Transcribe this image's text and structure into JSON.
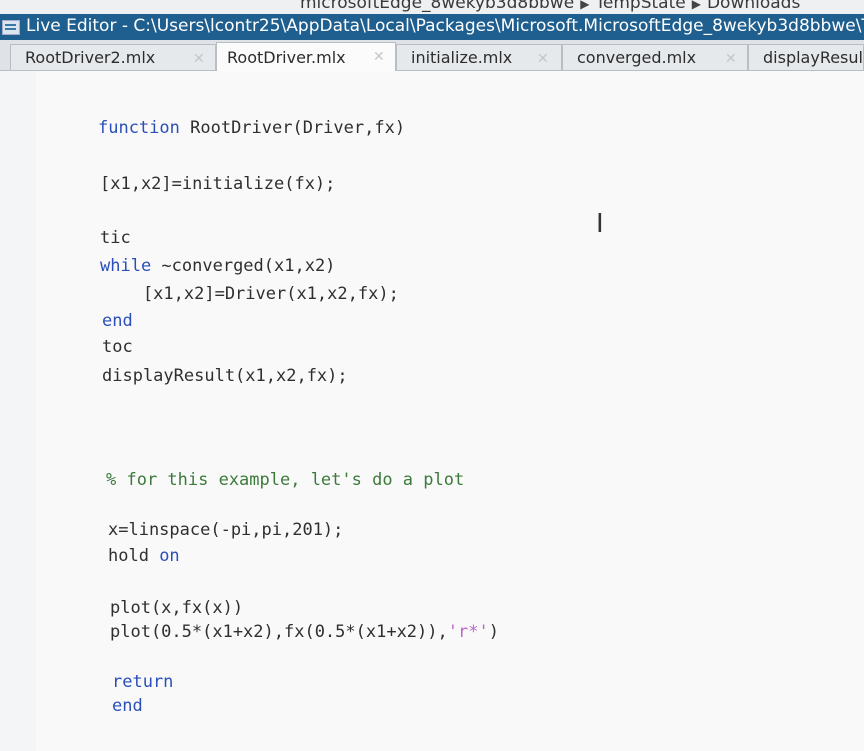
{
  "path_bar": {
    "crumbs": [
      "microsoftEdge_8wekyb3d8bbwe",
      "TempState",
      "Downloads"
    ]
  },
  "window": {
    "title": "Live Editor - C:\\Users\\lcontr25\\AppData\\Local\\Packages\\Microsoft.MicrosoftEdge_8wekyb3d8bbwe\\Te"
  },
  "tabs": [
    {
      "label": "RootDriver2.mlx",
      "active": false
    },
    {
      "label": "RootDriver.mlx",
      "active": true
    },
    {
      "label": "initialize.mlx",
      "active": false
    },
    {
      "label": "converged.mlx",
      "active": false
    },
    {
      "label": "displayResul",
      "active": false
    }
  ],
  "code": {
    "line1_kw": "function",
    "line1_rest": " RootDriver(Driver,fx)",
    "line2": "[x1,x2]=initialize(fx);",
    "line3": "tic",
    "line4_kw": "while",
    "line4_rest": " ~converged(x1,x2)",
    "line5": "    [x1,x2]=Driver(x1,x2,fx);",
    "line6_kw": "end",
    "line7": "toc",
    "line8": "displayResult(x1,x2,fx);",
    "comment": "% for this example, let's do a plot",
    "line10": "x=linspace(-pi,pi,201);",
    "line11_a": "hold ",
    "line11_kw": "on",
    "line12": "plot(x,fx(x))",
    "line13_a": "plot(0.5*(x1+x2),fx(0.5*(x1+x2)),",
    "line13_str": "'r*'",
    "line13_b": ")",
    "line14_kw": "return",
    "line15_kw": "end"
  },
  "colors": {
    "keyword": "#2b4fb8",
    "comment": "#3c7a3a",
    "string": "#b96acb",
    "titlebar": "#1f5f8f"
  }
}
